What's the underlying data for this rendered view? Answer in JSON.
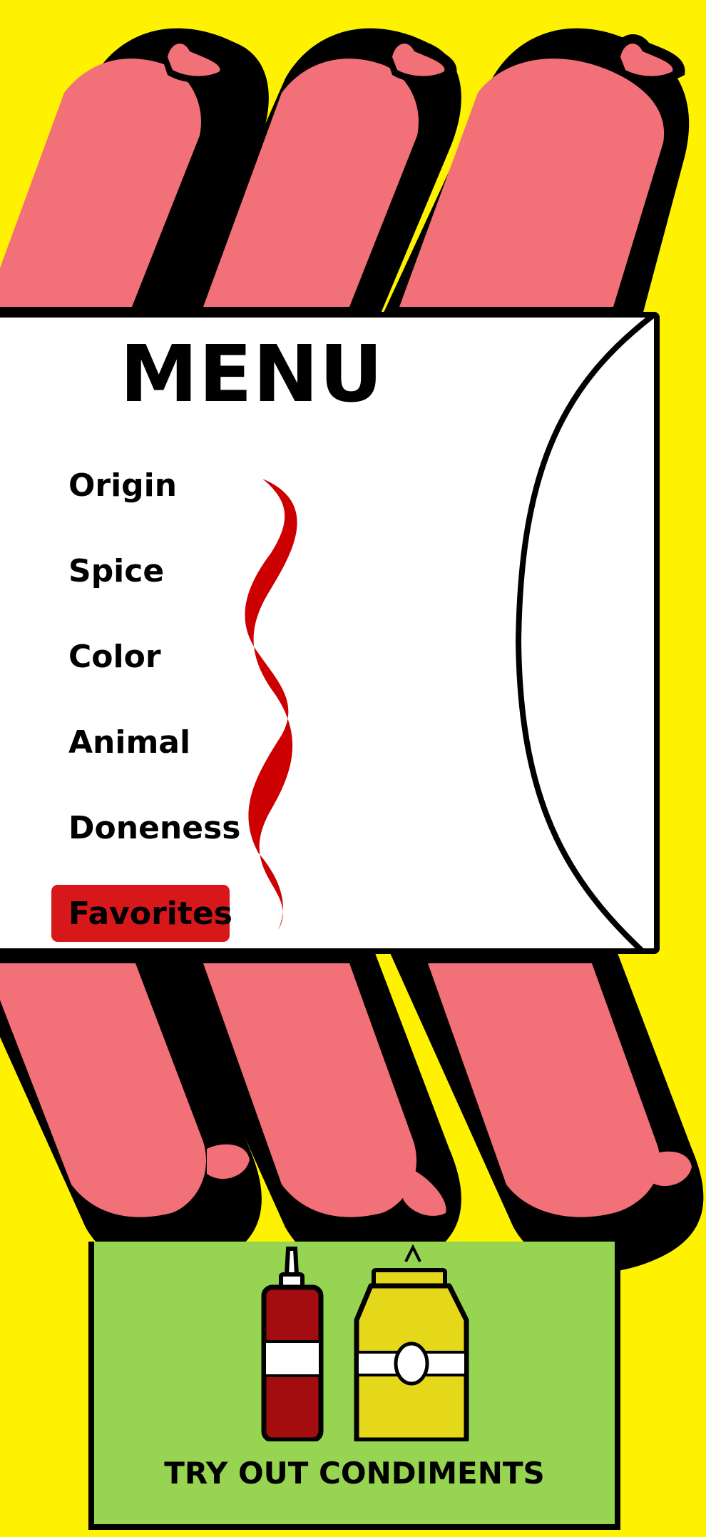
{
  "menu": {
    "title": "MENU",
    "items": [
      {
        "label": "Origin",
        "active": false
      },
      {
        "label": "Spice",
        "active": false
      },
      {
        "label": "Color",
        "active": false
      },
      {
        "label": "Animal",
        "active": false
      },
      {
        "label": "Doneness",
        "active": false
      },
      {
        "label": "Favorites",
        "active": true
      }
    ]
  },
  "condiments": {
    "label": "TRY OUT CONDIMENTS",
    "icons": [
      "ketchup-bottle-icon",
      "mustard-bottle-icon"
    ]
  },
  "decor": {
    "icons": [
      "sausage-icon",
      "mustard-squiggle-icon",
      "bun-icon"
    ]
  },
  "colors": {
    "background": "#fff200",
    "sausage": "#f27077",
    "outline": "#000000",
    "active_item": "#d6181b",
    "squiggle": "#cc0000",
    "condiments_panel": "#96d452",
    "ketchup": "#a30d0f",
    "mustard": "#e5d71a"
  }
}
